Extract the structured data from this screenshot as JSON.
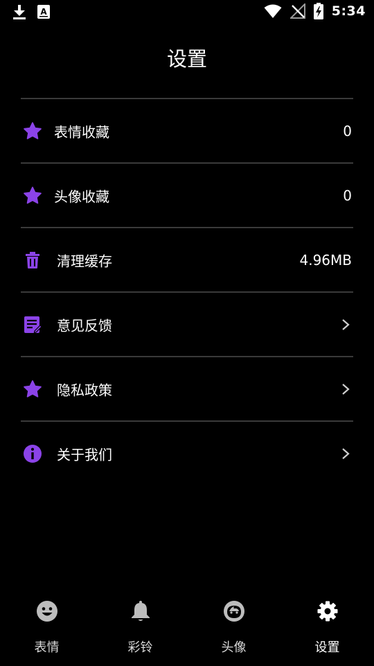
{
  "status_bar": {
    "time": "5:34",
    "icons": [
      "download-icon",
      "font-a-icon",
      "wifi-icon",
      "no-signal-icon",
      "battery-charging-icon"
    ],
    "font_icon_glyph": "A"
  },
  "header": {
    "title": "设置"
  },
  "colors": {
    "background": "#000000",
    "accent_purple": "#8b43e8",
    "divider": "#3a3a3a",
    "text": "#ffffff",
    "nav_inactive_icon": "#bdbdbd",
    "nav_active_icon": "#ffffff"
  },
  "settings": {
    "items": [
      {
        "icon": "star-icon",
        "label": "表情收藏",
        "value": "0"
      },
      {
        "icon": "star-icon",
        "label": "头像收藏",
        "value": "0"
      },
      {
        "icon": "trash-icon",
        "label": "清理缓存",
        "value": "4.96MB"
      },
      {
        "icon": "feedback-icon",
        "label": "意见反馈",
        "value": ""
      },
      {
        "icon": "star-icon",
        "label": "隐私政策",
        "value": ""
      },
      {
        "icon": "info-icon",
        "label": "关于我们",
        "value": ""
      }
    ]
  },
  "bottom_nav": {
    "items": [
      {
        "icon": "smiley-icon",
        "label": "表情",
        "active": false
      },
      {
        "icon": "bell-icon",
        "label": "彩铃",
        "active": false
      },
      {
        "icon": "avatar-face-icon",
        "label": "头像",
        "active": false
      },
      {
        "icon": "gear-icon",
        "label": "设置",
        "active": true
      }
    ]
  }
}
